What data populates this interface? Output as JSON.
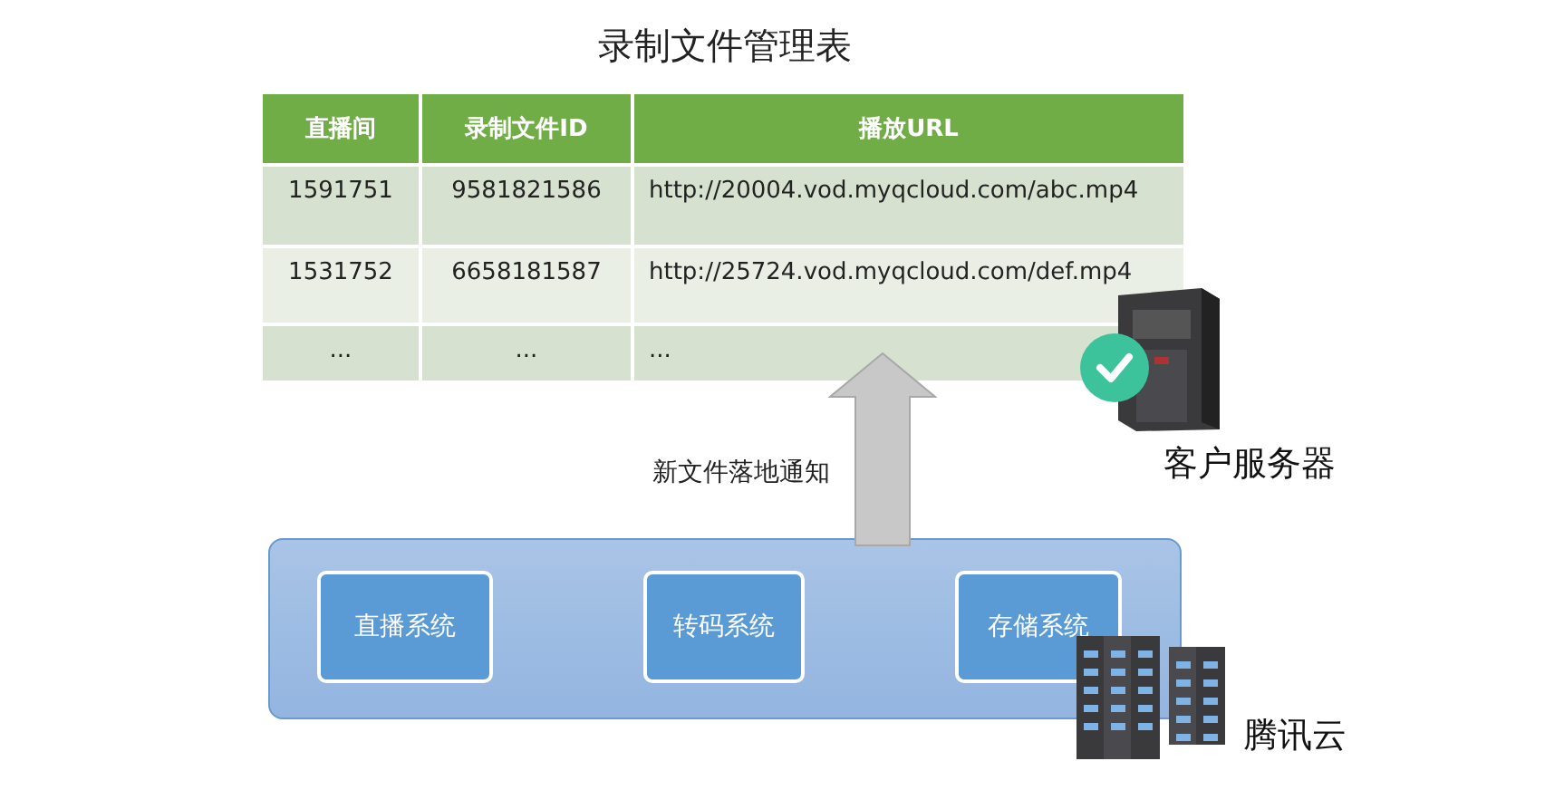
{
  "title": "录制文件管理表",
  "table": {
    "columns": [
      "直播间",
      "录制文件ID",
      "播放URL"
    ],
    "rows": [
      [
        "1591751",
        "9581821586",
        "http://20004.vod.myqcloud.com/abc.mp4"
      ],
      [
        "1531752",
        "6658181587",
        "http://25724.vod.myqcloud.com/def.mp4"
      ],
      [
        "...",
        "...",
        "..."
      ]
    ]
  },
  "arrow_label": "新文件落地通知",
  "customer_server": {
    "label": "客户服务器"
  },
  "cloud": {
    "label": "腾讯云",
    "systems": [
      "直播系统",
      "转码系统",
      "存储系统"
    ]
  }
}
